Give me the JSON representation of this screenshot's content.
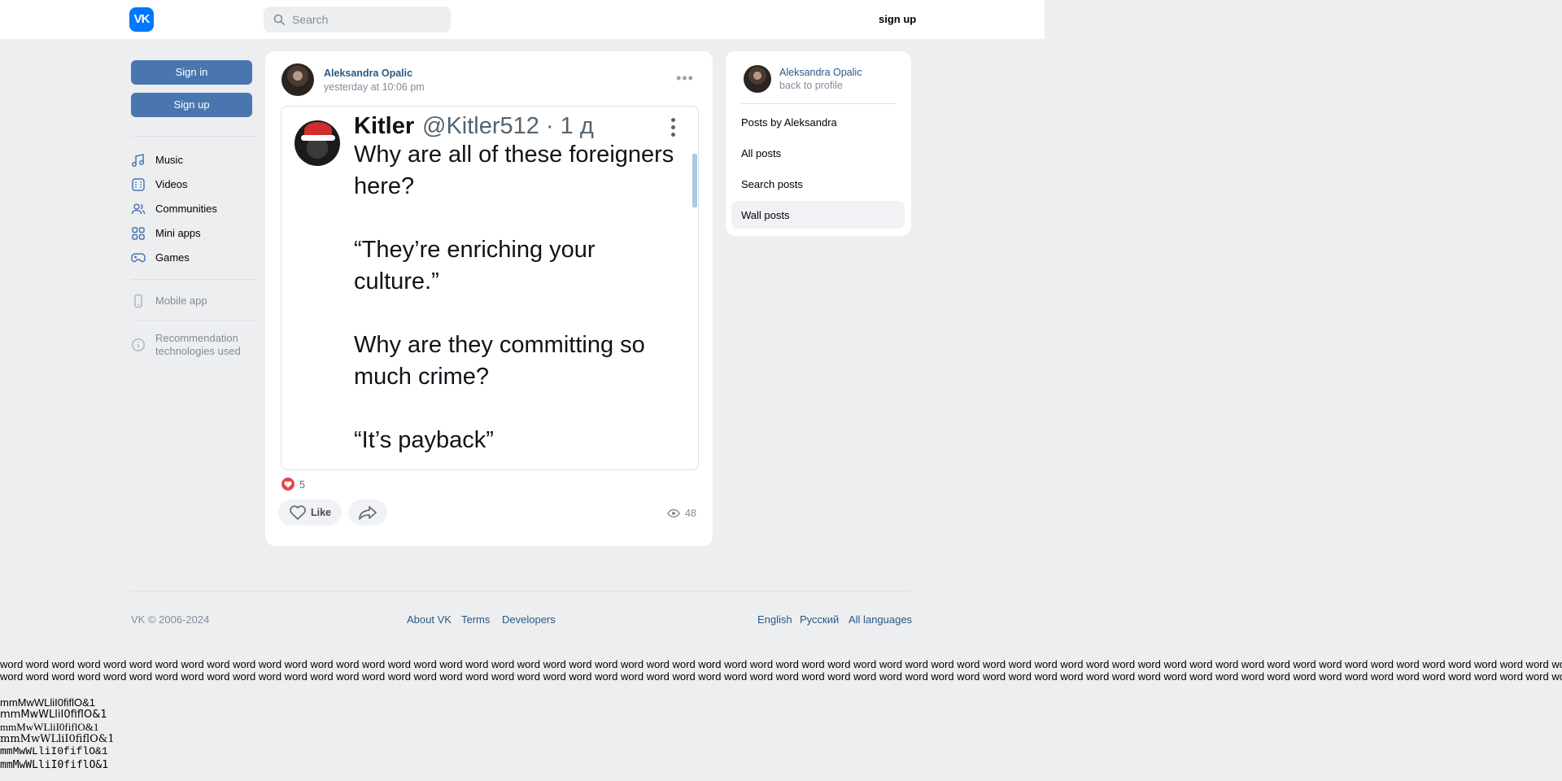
{
  "header": {
    "logo_text": "VK",
    "search_placeholder": "Search",
    "signup_label": "sign up"
  },
  "left": {
    "signin_label": "Sign in",
    "signup_label": "Sign up",
    "nav": [
      {
        "label": "Music",
        "icon": "music-icon"
      },
      {
        "label": "Videos",
        "icon": "video-icon"
      },
      {
        "label": "Communities",
        "icon": "communities-icon"
      },
      {
        "label": "Mini apps",
        "icon": "mini-apps-icon"
      },
      {
        "label": "Games",
        "icon": "gamepad-icon"
      }
    ],
    "mobile_app": "Mobile app",
    "recommendation_line1": "Recommendation",
    "recommendation_line2": "technologies used"
  },
  "post": {
    "author": "Aleksandra Opalic",
    "time": "yesterday at 10:06 pm",
    "menu_icon": "more-horizontal-icon",
    "tweet": {
      "name": "Kitler",
      "handle": "@Kitler512 · 1 д",
      "lines": [
        "Why are all of these foreigners",
        "here?",
        "“They’re enriching your",
        "culture.”",
        "Why are they committing so",
        "much crime?",
        "“It’s payback”"
      ]
    },
    "like_count": "5",
    "like_label": "Like",
    "views": "48"
  },
  "right_panel": {
    "name": "Aleksandra Opalic",
    "back": "back to profile",
    "items": [
      "Posts by Aleksandra",
      "All posts",
      "Search posts",
      "Wall posts"
    ],
    "active_item": "Wall posts"
  },
  "footer": {
    "copyright": "VK © 2006-2024",
    "links_center": [
      "About VK",
      "Terms",
      "Developers"
    ],
    "links_right": [
      "English",
      "Русский",
      "All languages"
    ]
  },
  "filler": {
    "words_line": "word word word word word word word word word word word word word word word word word word word word word word word word word word word word word word word word word word word word word word word word word word word word word word word word word word word word word word word word word word word word word word",
    "samples": [
      "mmMwWLliI0fiflO&1",
      "mmMwWLliI0fiflO&1",
      "mmMwWLliI0fiflO&1",
      "mmMwWLliI0fiflO&1",
      "mmMwWLliI0fiflO&1",
      "mmMwWLliI0fiflO&1"
    ]
  },
  "colors": {
    "brand": "#0077ff",
    "button": "#4a76b0",
    "link": "#2a5885",
    "background": "#edeef0",
    "like": "#e64646"
  }
}
